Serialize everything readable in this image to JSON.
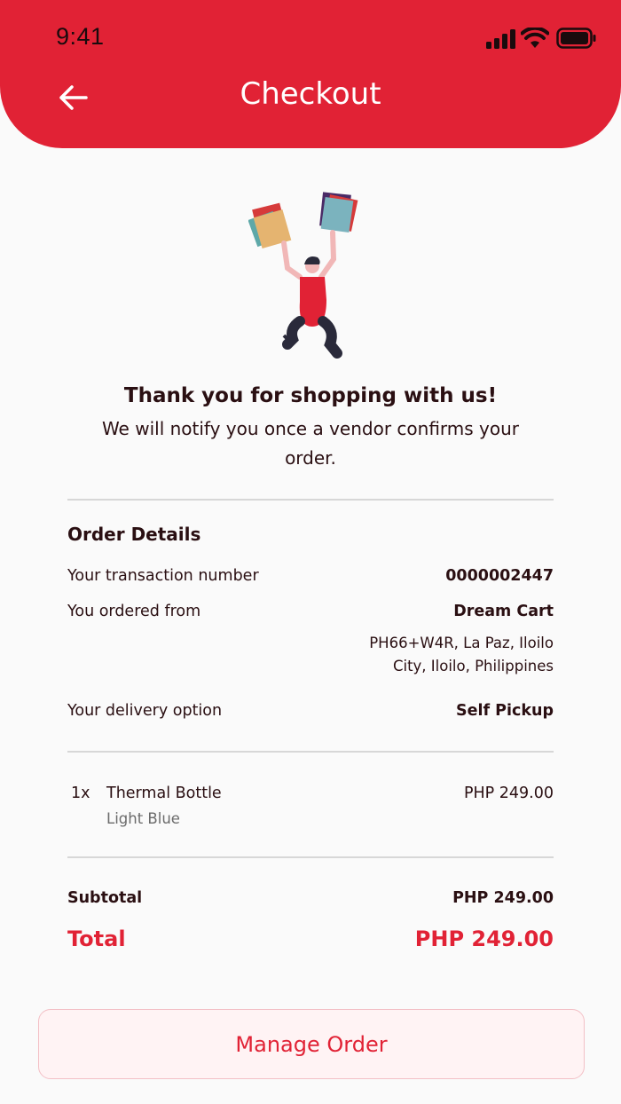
{
  "status_bar": {
    "time": "9:41"
  },
  "header": {
    "title": "Checkout"
  },
  "thanks": {
    "title": "Thank you for shopping with us!",
    "subtitle": "We will notify you once a vendor confirms your order."
  },
  "order_details": {
    "title": "Order Details",
    "transaction_label": "Your transaction number",
    "transaction_number": "0000002447",
    "ordered_from_label": "You ordered from",
    "store_name": "Dream Cart",
    "store_address": "PH66+W4R, La Paz, Iloilo City, Iloilo, Philippines",
    "delivery_label": "Your delivery option",
    "delivery_option": "Self Pickup"
  },
  "items": [
    {
      "qty": "1x",
      "name": "Thermal Bottle",
      "variant": "Light Blue",
      "price": "PHP 249.00"
    }
  ],
  "summary": {
    "subtotal_label": "Subtotal",
    "subtotal_value": "PHP 249.00",
    "total_label": "Total",
    "total_value": "PHP 249.00"
  },
  "actions": {
    "manage_order_label": "Manage Order"
  },
  "colors": {
    "brand": "#e12235",
    "text": "#2a0f12",
    "muted": "#6b6b6b"
  },
  "icons": [
    "cellular-signal-icon",
    "wifi-icon",
    "battery-icon",
    "back-arrow-icon"
  ]
}
